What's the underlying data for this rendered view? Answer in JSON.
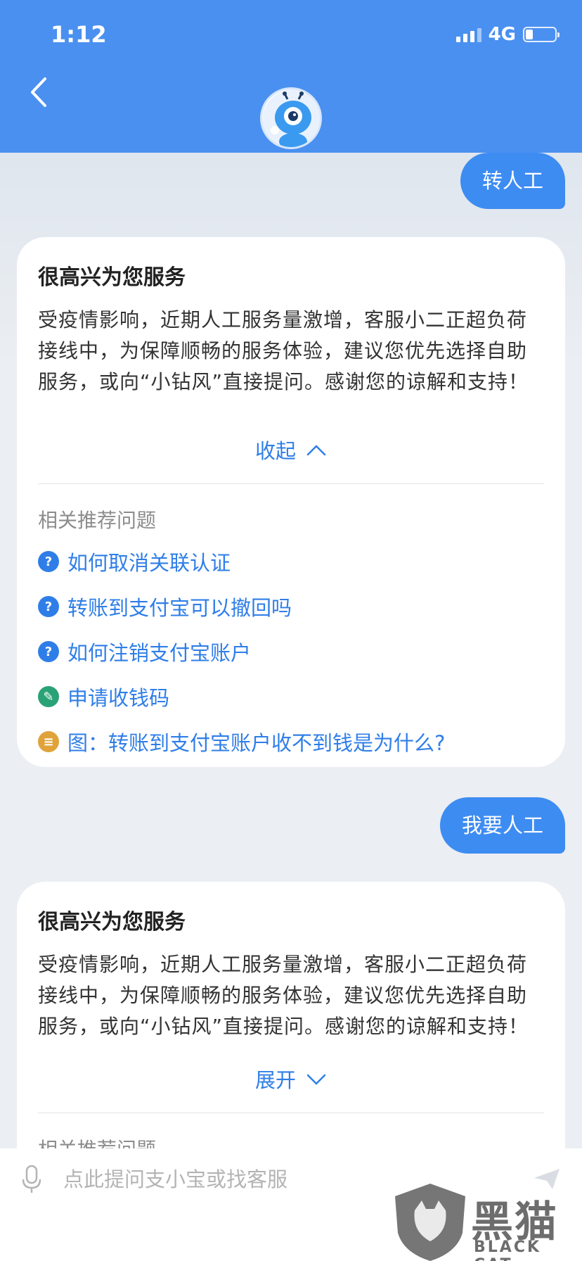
{
  "status_bar": {
    "time": "1:12",
    "network": "4G"
  },
  "header": {
    "back_icon": "chevron-left-icon",
    "avatar_icon": "robot-assistant-avatar"
  },
  "messages": {
    "user_1": "转人工",
    "card_1": {
      "title": "很高兴为您服务",
      "body": "受疫情影响，近期人工服务量激增，客服小二正超负荷接线中，为保障顺畅的服务体验，建议您优先选择自助服务，或向“小钻风”直接提问。感谢您的谅解和支持！",
      "toggle_label": "收起",
      "rec_title": "相关推荐问题",
      "items": [
        {
          "label": "如何取消关联认证",
          "icon": "question-icon",
          "color": "#2f7ee8"
        },
        {
          "label": "转账到支付宝可以撤回吗",
          "icon": "question-icon",
          "color": "#2f7ee8"
        },
        {
          "label": "如何注销支付宝账户",
          "icon": "question-icon",
          "color": "#2f7ee8"
        },
        {
          "label": "申请收钱码",
          "icon": "wrench-icon",
          "color": "#2aa277"
        },
        {
          "label": "图：转账到支付宝账户收不到钱是为什么?",
          "icon": "document-icon",
          "color": "#e0a33a"
        }
      ]
    },
    "user_2": "我要人工",
    "card_2": {
      "title": "很高兴为您服务",
      "body": "受疫情影响，近期人工服务量激增，客服小二正超负荷接线中，为保障顺畅的服务体验，建议您优先选择自助服务，或向“小钻风”直接提问。感谢您的谅解和支持！",
      "toggle_label": "展开",
      "rec_title": "相关推荐问题"
    }
  },
  "input_bar": {
    "placeholder": "点此提问支小宝或找客服"
  },
  "watermark": {
    "main": "黑猫",
    "sub": "BLACK CAT"
  }
}
